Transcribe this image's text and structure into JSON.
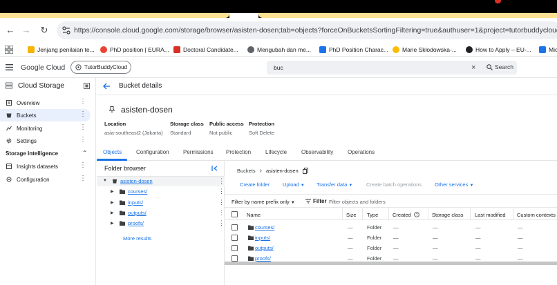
{
  "browser": {
    "url": "https://console.cloud.google.com/storage/browser/asisten-dosen;tab=objects?forceOnBucketsSortingFiltering=true&authuser=1&project=tutorbuddycloud&prefi...",
    "bookmarks": [
      {
        "label": "Jenjang penilaian te...",
        "color": "#f4b400"
      },
      {
        "label": "PhD position | EURA...",
        "color": "#ea4335"
      },
      {
        "label": "Doctoral Candidate...",
        "color": "#d93025"
      },
      {
        "label": "Mengubah dan me...",
        "color": "#5f6368"
      },
      {
        "label": "PhD Position Charac...",
        "color": "#1a73e8"
      },
      {
        "label": "Marie Skłodowska-...",
        "color": "#fbbc04"
      },
      {
        "label": "How to Apply – EU-...",
        "color": "#202124"
      },
      {
        "label": "Mic",
        "color": "#1a73e8"
      }
    ]
  },
  "header": {
    "brand": "Google Cloud",
    "project": "TutorBuddyCloud",
    "search_query": "buc",
    "search_button": "Search"
  },
  "sidebar": {
    "title": "Cloud Storage",
    "items": [
      {
        "label": "Overview",
        "active": false
      },
      {
        "label": "Buckets",
        "active": true
      },
      {
        "label": "Monitoring",
        "active": false
      },
      {
        "label": "Settings",
        "active": false
      }
    ],
    "section": "Storage Intelligence",
    "section_items": [
      {
        "label": "Insights datasets"
      },
      {
        "label": "Configuration"
      }
    ]
  },
  "page": {
    "title": "Bucket details",
    "bucket_name": "asisten-dosen",
    "meta": [
      {
        "key": "Location",
        "value": "asia-southeast2 (Jakarta)"
      },
      {
        "key": "Storage class",
        "value": "Standard"
      },
      {
        "key": "Public access",
        "value": "Not public"
      },
      {
        "key": "Protection",
        "value": "Soft Delete"
      }
    ],
    "tabs": [
      "Objects",
      "Configuration",
      "Permissions",
      "Protection",
      "Lifecycle",
      "Observability",
      "Operations"
    ],
    "active_tab": "Objects"
  },
  "folder_browser": {
    "title": "Folder browser",
    "root": "asisten-dosen",
    "folders": [
      "courses/",
      "inputs/",
      "outputs/",
      "proofs/"
    ],
    "more": "More results"
  },
  "objects": {
    "breadcrumb_root": "Buckets",
    "breadcrumb_current": "asisten-dosen",
    "actions": {
      "create_folder": "Create folder",
      "upload": "Upload",
      "transfer": "Transfer data",
      "batch": "Create batch operations",
      "other": "Other services"
    },
    "filter": {
      "prefix": "Filter by name prefix only",
      "label": "Filter",
      "placeholder": "Filter objects and folders"
    },
    "columns": [
      "Name",
      "Size",
      "Type",
      "Created",
      "Storage class",
      "Last modified",
      "Custom contexts"
    ],
    "rows": [
      {
        "name": "courses/",
        "size": "—",
        "type": "Folder",
        "created": "—",
        "storage": "—",
        "modified": "—",
        "contexts": "—"
      },
      {
        "name": "inputs/",
        "size": "—",
        "type": "Folder",
        "created": "—",
        "storage": "—",
        "modified": "—",
        "contexts": "—"
      },
      {
        "name": "outputs/",
        "size": "—",
        "type": "Folder",
        "created": "—",
        "storage": "—",
        "modified": "—",
        "contexts": "—"
      },
      {
        "name": "proofs/",
        "size": "—",
        "type": "Folder",
        "created": "—",
        "storage": "—",
        "modified": "—",
        "contexts": "—"
      }
    ]
  }
}
